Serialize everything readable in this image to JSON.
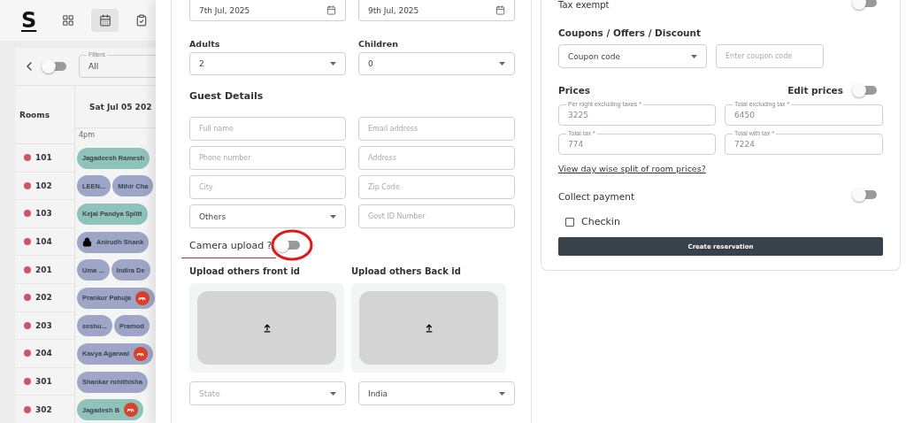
{
  "topbar": {
    "logo": "S",
    "nav": [
      {
        "selected": false
      },
      {
        "selected": true
      },
      {
        "selected": false
      }
    ]
  },
  "filter_bar": {
    "toggle_on": false,
    "filter": {
      "label": "Filters",
      "value": "All"
    }
  },
  "calendar": {
    "rooms_header": "Rooms",
    "date_header": "Sat Jul 05 202",
    "time_label": "4pm",
    "rooms": [
      {
        "number": "101",
        "bookings": [
          {
            "name": "Jagadeesh Ramesh",
            "color": "#8fc2b8",
            "locked": false,
            "ota_badge": false
          }
        ]
      },
      {
        "number": "102",
        "bookings": [
          {
            "name": "LEEN...",
            "color": "#9da6c6",
            "locked": false,
            "ota_badge": false
          },
          {
            "name": "Mihir Cha",
            "color": "#9da6c6",
            "locked": false,
            "ota_badge": false
          }
        ]
      },
      {
        "number": "103",
        "bookings": [
          {
            "name": "Kejal Pandya Splitt",
            "color": "#8fc2b8",
            "locked": false,
            "ota_badge": false
          }
        ]
      },
      {
        "number": "104",
        "bookings": [
          {
            "name": "Anirudh Shank",
            "color": "#9da6c6",
            "locked": true,
            "ota_badge": false
          }
        ]
      },
      {
        "number": "201",
        "bookings": [
          {
            "name": "Uma ...",
            "color": "#9da6c6",
            "locked": false,
            "ota_badge": false
          },
          {
            "name": "Indira De",
            "color": "#9da6c6",
            "locked": false,
            "ota_badge": false
          }
        ]
      },
      {
        "number": "202",
        "bookings": [
          {
            "name": "Prankur Pahuja",
            "color": "#9da6c6",
            "locked": false,
            "ota_badge": true
          }
        ]
      },
      {
        "number": "203",
        "bookings": [
          {
            "name": "seshu...",
            "color": "#9da6c6",
            "locked": false,
            "ota_badge": false
          },
          {
            "name": "Pramod",
            "color": "#9da6c6",
            "locked": false,
            "ota_badge": false
          }
        ]
      },
      {
        "number": "204",
        "bookings": [
          {
            "name": "Kavya Agarwal",
            "color": "#9da6c6",
            "locked": false,
            "ota_badge": true
          }
        ]
      },
      {
        "number": "301",
        "bookings": [
          {
            "name": "Shankar rohithisha",
            "color": "#9da6c6",
            "locked": false,
            "ota_badge": false
          }
        ]
      },
      {
        "number": "302",
        "bookings": [
          {
            "name": "Jagadesh B",
            "color": "#8fc2b8",
            "locked": false,
            "ota_badge": true
          }
        ]
      }
    ]
  },
  "booking_form": {
    "dates": [
      "7th Jul, 2025",
      "9th Jul, 2025"
    ],
    "occupancy": [
      {
        "label": "Adults",
        "value": "2"
      },
      {
        "label": "Children",
        "value": "0"
      }
    ],
    "guest_heading": "Guest Details",
    "guest_fields": [
      {
        "kind": "input",
        "placeholder": "Full name"
      },
      {
        "kind": "input",
        "placeholder": "Email address"
      },
      {
        "kind": "input",
        "placeholder": "Phone number"
      },
      {
        "kind": "input",
        "placeholder": "Address"
      },
      {
        "kind": "input",
        "placeholder": "City"
      },
      {
        "kind": "input",
        "placeholder": "Zip Code"
      },
      {
        "kind": "select",
        "value": "Others"
      },
      {
        "kind": "input",
        "placeholder": "Govt ID Number"
      }
    ],
    "camera_upload": {
      "label": "Camera upload ?",
      "on": false
    },
    "uploads": [
      {
        "label": "Upload others front id"
      },
      {
        "label": "Upload others Back id"
      }
    ],
    "location": [
      {
        "placeholder": "State"
      },
      {
        "value": "India"
      }
    ]
  },
  "summary": {
    "tax_exempt": {
      "label": "Tax exempt",
      "on": false
    },
    "coupon_heading": "Coupons / Offers / Discount",
    "coupon_select": "Coupon code",
    "coupon_placeholder": "Enter coupon code",
    "prices_heading": "Prices",
    "edit_prices": {
      "label": "Edit prices",
      "on": false
    },
    "prices": [
      {
        "label": "Per night excluding taxes *",
        "value": "3225",
        "disabled": true
      },
      {
        "label": "Total excluding tax *",
        "value": "6450",
        "disabled": true
      },
      {
        "label": "Total tax *",
        "value": "774",
        "disabled": true
      },
      {
        "label": "Total with tax *",
        "value": "7224",
        "disabled": true
      }
    ],
    "split_link": "View day wise split of room prices?",
    "collect_payment": {
      "label": "Collect payment",
      "on": false
    },
    "checkin": {
      "label": "Checkin",
      "checked": false
    },
    "submit": "Create reservation"
  }
}
